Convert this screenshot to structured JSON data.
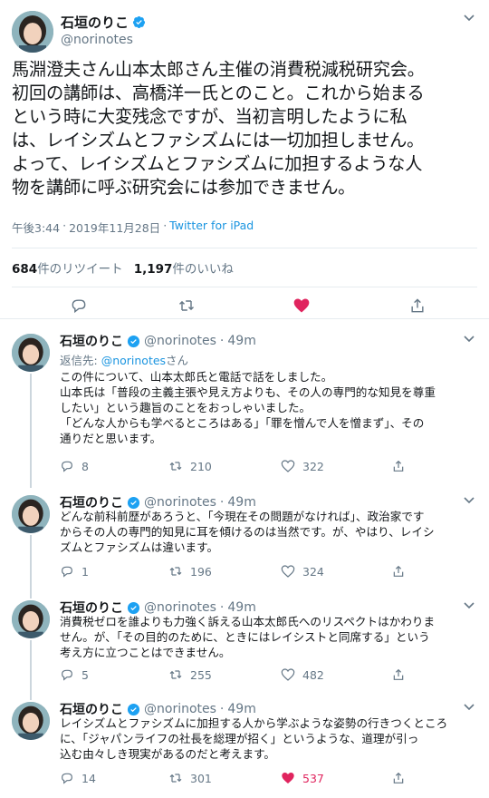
{
  "main_tweet": {
    "name": "石垣のりこ",
    "handle": "@norinotes",
    "text": "馬淵澄夫さん山本太郎さん主催の消費税減税研究会。\n初回の講師は、高橋洋一氏とのこと。これから始まる\nという時に大変残念ですが、当初言明したように私\nは、レイシズムとファシズムには一切加担しません。\nよって、レイシズムとファシズムに加担するような人\n物を講師に呼ぶ研究会には参加できません。",
    "time": "午後3:44",
    "date": "2019年11月28日",
    "separator": "·",
    "source": "Twitter for iPad",
    "retweets_count": "684",
    "retweets_label": "件のリツイート",
    "likes_count": "1,197",
    "likes_label": "件のいいね",
    "liked": true,
    "like_color": "#e0245e"
  },
  "replies": [
    {
      "name": "石垣のりこ",
      "handle": "@norinotes",
      "time": "49m",
      "reply_to_prefix": "返信先: ",
      "reply_to_mention": "@norinotes",
      "reply_to_suffix": "さん",
      "text": "この件について、山本太郎氏と電話で話をしました。\n山本氏は「普段の主義主張や見え方よりも、その人の専門的な知見を尊重\nしたい」という趣旨のことをおっしゃいました。\n「どんな人からも学べるところはある」「罪を憎んで人を憎まず」、その\n通りだと思います。",
      "replies": "8",
      "retweets": "210",
      "likes": "322",
      "liked": false
    },
    {
      "name": "石垣のりこ",
      "handle": "@norinotes",
      "time": "49m",
      "text": "どんな前科前歴があろうと、「今現在その問題がなければ」、政治家です\nからその人の専門的知見に耳を傾けるのは当然です。が、やはり、レイシ\nズムとファシズムは違います。",
      "replies": "1",
      "retweets": "196",
      "likes": "324",
      "liked": false
    },
    {
      "name": "石垣のりこ",
      "handle": "@norinotes",
      "time": "49m",
      "text": "消費税ゼロを誰よりも力強く訴える山本太郎氏へのリスペクトはかわりま\nせん。が、「その目的のために、ときにはレイシストと同席する」という\n考え方に立つことはできません。",
      "replies": "5",
      "retweets": "255",
      "likes": "482",
      "liked": false
    },
    {
      "name": "石垣のりこ",
      "handle": "@norinotes",
      "time": "49m",
      "text": "レイシズムとファシズムに加担する人から学ぶような姿勢の行きつくところ\nに、「ジャパンライフの社長を総理が招く」というような、道理が引っ\n込む由々しき現実があるのだと考えます。",
      "replies": "14",
      "retweets": "301",
      "likes": "537",
      "liked": true
    }
  ],
  "colors": {
    "verified": "#1da1f2",
    "link": "#1b95e0",
    "muted": "#657786",
    "like": "#e0245e"
  }
}
